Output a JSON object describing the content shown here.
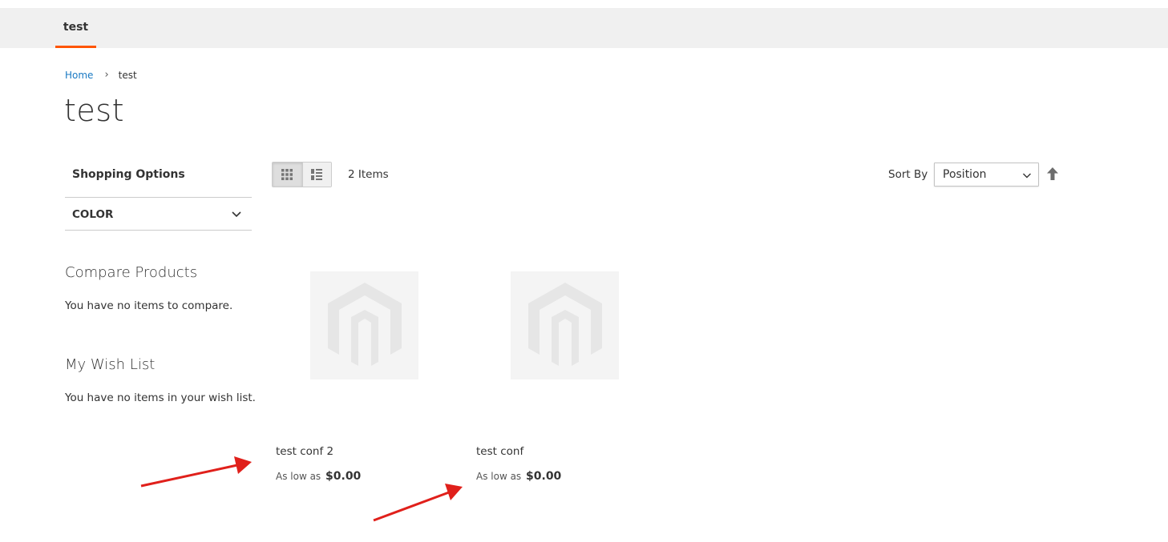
{
  "nav": {
    "items": [
      {
        "label": "test"
      }
    ]
  },
  "breadcrumb": {
    "home": "Home",
    "separator": "›",
    "current": "test"
  },
  "page": {
    "title": "test"
  },
  "sidebar": {
    "shopping_options_title": "Shopping Options",
    "filters": [
      {
        "label": "COLOR",
        "icon": "chevron-down-icon"
      }
    ],
    "compare": {
      "title": "Compare Products",
      "empty_text": "You have no items to compare."
    },
    "wishlist": {
      "title": "My Wish List",
      "empty_text": "You have no items in your wish list."
    }
  },
  "toolbar": {
    "modes": [
      {
        "name": "grid",
        "active": true,
        "icon": "grid-icon"
      },
      {
        "name": "list",
        "active": false,
        "icon": "list-icon"
      }
    ],
    "item_count": "2 Items",
    "sort_label": "Sort By",
    "sort_value": "Position",
    "sort_options": [
      "Position"
    ],
    "sort_direction_icon": "arrow-up-icon"
  },
  "products": [
    {
      "name": "test conf 2",
      "price_label": "As low as",
      "price": "$0.00",
      "image": "placeholder-logo-icon"
    },
    {
      "name": "test conf",
      "price_label": "As low as",
      "price": "$0.00",
      "image": "placeholder-logo-icon"
    }
  ],
  "colors": {
    "accent": "#ff5501",
    "link": "#1979c3",
    "nav_bg": "#f0f0f0",
    "annotation": "#e0201b"
  }
}
